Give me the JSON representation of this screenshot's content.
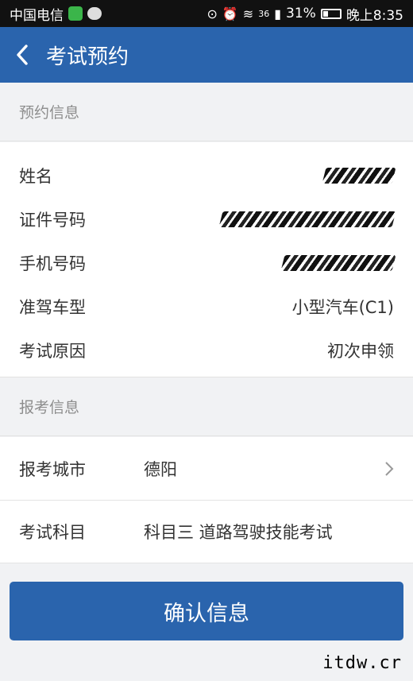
{
  "status_bar": {
    "carrier": "中国电信",
    "signal_text": "36",
    "battery_percent": "31%",
    "time": "晚上8:35",
    "battery_level": 0.31
  },
  "navbar": {
    "title": "考试预约",
    "back_icon": "chevron-left-icon"
  },
  "booking_info": {
    "section_title": "预约信息",
    "rows": [
      {
        "label": "姓名",
        "value": "",
        "masked": true
      },
      {
        "label": "证件号码",
        "value": "",
        "masked": true
      },
      {
        "label": "手机号码",
        "value": "",
        "masked": true
      },
      {
        "label": "准驾车型",
        "value": "小型汽车(C1)"
      },
      {
        "label": "考试原因",
        "value": "初次申领"
      }
    ]
  },
  "exam_info": {
    "section_title": "报考信息",
    "city_label": "报考城市",
    "city_value": "德阳",
    "subject_label": "考试科目",
    "subject_value": "科目三 道路驾驶技能考试"
  },
  "confirm_button": "确认信息",
  "watermark": "itdw.cr",
  "colors": {
    "primary": "#2a64ad",
    "background": "#f1f2f4"
  }
}
